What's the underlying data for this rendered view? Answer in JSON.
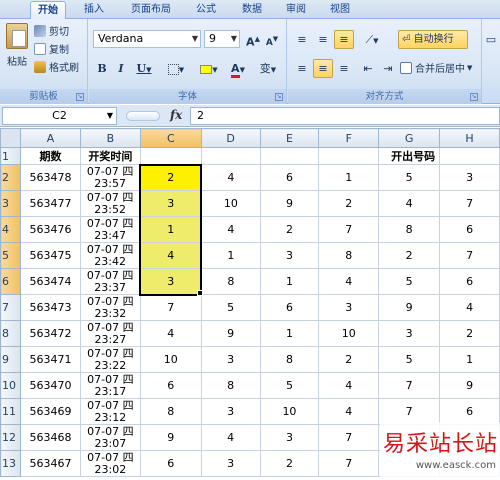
{
  "tabs": [
    {
      "label": "开始",
      "active": true
    },
    {
      "label": "插入"
    },
    {
      "label": "页面布局"
    },
    {
      "label": "公式"
    },
    {
      "label": "数据"
    },
    {
      "label": "审阅"
    },
    {
      "label": "视图"
    }
  ],
  "clipboard": {
    "paste": "粘贴",
    "cut": "剪切",
    "copy": "复制",
    "format_painter": "格式刷",
    "group_label": "剪贴板"
  },
  "font": {
    "name": "Verdana",
    "size": "9",
    "group_label": "字体",
    "grow_label": "A",
    "shrink_label": "A",
    "bold": "B",
    "italic": "I",
    "underline": "U",
    "font_color_label": "A",
    "phonetic_label": "变"
  },
  "alignment": {
    "wrap_text": "自动换行",
    "merge_center": "合并后居中",
    "group_label": "对齐方式"
  },
  "formula_bar": {
    "name_box": "C2",
    "fx": "fx",
    "value": "2"
  },
  "sheet": {
    "columns": [
      "A",
      "B",
      "C",
      "D",
      "E",
      "F",
      "G",
      "H"
    ],
    "header_row": {
      "period": "期数",
      "draw_time": "开奖时间",
      "numbers": "开出号码"
    },
    "rows": [
      {
        "num": "2",
        "period": "563478",
        "date": "07-07 四",
        "time": "23:57",
        "c": "2",
        "d": "4",
        "e": "6",
        "f": "1",
        "g": "5",
        "h": "3"
      },
      {
        "num": "3",
        "period": "563477",
        "date": "07-07 四",
        "time": "23:52",
        "c": "3",
        "d": "10",
        "e": "9",
        "f": "2",
        "g": "4",
        "h": "7"
      },
      {
        "num": "4",
        "period": "563476",
        "date": "07-07 四",
        "time": "23:47",
        "c": "1",
        "d": "4",
        "e": "2",
        "f": "7",
        "g": "8",
        "h": "6"
      },
      {
        "num": "5",
        "period": "563475",
        "date": "07-07 四",
        "time": "23:42",
        "c": "4",
        "d": "1",
        "e": "3",
        "f": "8",
        "g": "2",
        "h": "7"
      },
      {
        "num": "6",
        "period": "563474",
        "date": "07-07 四",
        "time": "23:37",
        "c": "3",
        "d": "8",
        "e": "1",
        "f": "4",
        "g": "5",
        "h": "6"
      },
      {
        "num": "7",
        "period": "563473",
        "date": "07-07 四",
        "time": "23:32",
        "c": "7",
        "d": "5",
        "e": "6",
        "f": "3",
        "g": "9",
        "h": "4"
      },
      {
        "num": "8",
        "period": "563472",
        "date": "07-07 四",
        "time": "23:27",
        "c": "4",
        "d": "9",
        "e": "1",
        "f": "10",
        "g": "3",
        "h": "2"
      },
      {
        "num": "9",
        "period": "563471",
        "date": "07-07 四",
        "time": "23:22",
        "c": "10",
        "d": "3",
        "e": "8",
        "f": "2",
        "g": "5",
        "h": "1"
      },
      {
        "num": "10",
        "period": "563470",
        "date": "07-07 四",
        "time": "23:17",
        "c": "6",
        "d": "8",
        "e": "5",
        "f": "4",
        "g": "7",
        "h": "9"
      },
      {
        "num": "11",
        "period": "563469",
        "date": "07-07 四",
        "time": "23:12",
        "c": "8",
        "d": "3",
        "e": "10",
        "f": "4",
        "g": "7",
        "h": "6"
      },
      {
        "num": "12",
        "period": "563468",
        "date": "07-07 四",
        "time": "23:07",
        "c": "9",
        "d": "4",
        "e": "3",
        "f": "7",
        "g": "",
        "h": ""
      },
      {
        "num": "13",
        "period": "563467",
        "date": "07-07 四",
        "time": "23:02",
        "c": "6",
        "d": "3",
        "e": "2",
        "f": "7",
        "g": "",
        "h": ""
      }
    ],
    "highlight_color": "#fff000",
    "range_fill_color": "#f0ec6b"
  },
  "watermark": {
    "title": "易采站长站",
    "url": "www.easck.com"
  }
}
